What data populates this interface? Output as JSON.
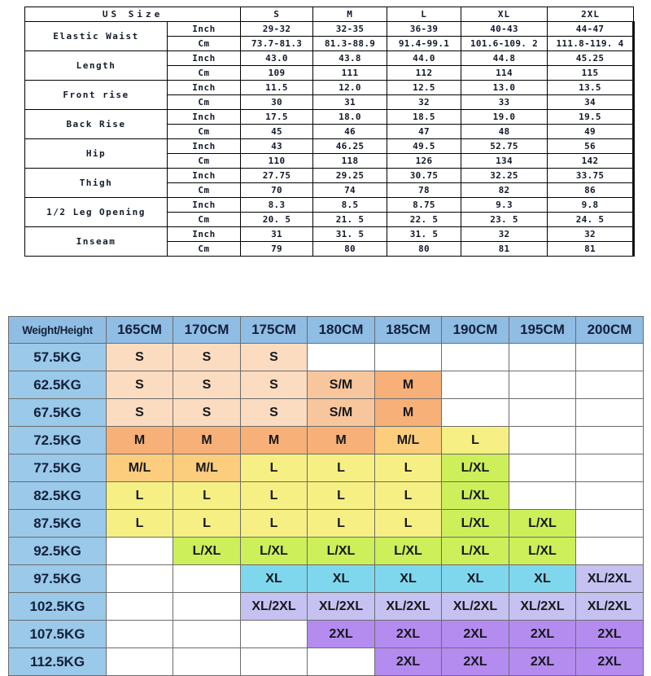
{
  "top_table": {
    "title": "US Size",
    "size_columns": [
      "S",
      "M",
      "L",
      "XL",
      "2XL"
    ],
    "units": [
      "Inch",
      "Cm"
    ],
    "rows": [
      {
        "label": "Elastic Waist",
        "inch": [
          "29-32",
          "32-35",
          "36-39",
          "40-43",
          "44-47"
        ],
        "cm": [
          "73.7-81.3",
          "81.3-88.9",
          "91.4-99.1",
          "101.6-109. 2",
          "111.8-119. 4"
        ]
      },
      {
        "label": "Length",
        "inch": [
          "43.0",
          "43.8",
          "44.0",
          "44.8",
          "45.25"
        ],
        "cm": [
          "109",
          "111",
          "112",
          "114",
          "115"
        ]
      },
      {
        "label": "Front rise",
        "inch": [
          "11.5",
          "12.0",
          "12.5",
          "13.0",
          "13.5"
        ],
        "cm": [
          "30",
          "31",
          "32",
          "33",
          "34"
        ]
      },
      {
        "label": "Back Rise",
        "inch": [
          "17.5",
          "18.0",
          "18.5",
          "19.0",
          "19.5"
        ],
        "cm": [
          "45",
          "46",
          "47",
          "48",
          "49"
        ]
      },
      {
        "label": "Hip",
        "inch": [
          "43",
          "46.25",
          "49.5",
          "52.75",
          "56"
        ],
        "cm": [
          "110",
          "118",
          "126",
          "134",
          "142"
        ]
      },
      {
        "label": "Thigh",
        "inch": [
          "27.75",
          "29.25",
          "30.75",
          "32.25",
          "33.75"
        ],
        "cm": [
          "70",
          "74",
          "78",
          "82",
          "86"
        ]
      },
      {
        "label": "1/2 Leg Opening",
        "inch": [
          "8.3",
          "8.5",
          "8.75",
          "9.3",
          "9.8"
        ],
        "cm": [
          "20. 5",
          "21. 5",
          "22. 5",
          "23. 5",
          "24. 5"
        ]
      },
      {
        "label": "Inseam",
        "inch": [
          "31",
          "31. 5",
          "31. 5",
          "32",
          "32"
        ],
        "cm": [
          "79",
          "80",
          "80",
          "81",
          "81"
        ]
      }
    ]
  },
  "bottom_table": {
    "corner_label": "Weight/Height",
    "height_columns": [
      "165CM",
      "170CM",
      "175CM",
      "180CM",
      "185CM",
      "190CM",
      "195CM",
      "200CM"
    ],
    "rows": [
      {
        "weight": "57.5KG",
        "cells": [
          "S",
          "S",
          "S",
          "",
          "",
          "",
          "",
          ""
        ]
      },
      {
        "weight": "62.5KG",
        "cells": [
          "S",
          "S",
          "S",
          "S/M",
          "M",
          "",
          "",
          ""
        ]
      },
      {
        "weight": "67.5KG",
        "cells": [
          "S",
          "S",
          "S",
          "S/M",
          "M",
          "",
          "",
          ""
        ]
      },
      {
        "weight": "72.5KG",
        "cells": [
          "M",
          "M",
          "M",
          "M",
          "M/L",
          "L",
          "",
          ""
        ]
      },
      {
        "weight": "77.5KG",
        "cells": [
          "M/L",
          "M/L",
          "L",
          "L",
          "L",
          "L/XL",
          "",
          ""
        ]
      },
      {
        "weight": "82.5KG",
        "cells": [
          "L",
          "L",
          "L",
          "L",
          "L",
          "L/XL",
          "",
          ""
        ]
      },
      {
        "weight": "87.5KG",
        "cells": [
          "L",
          "L",
          "L",
          "L",
          "L",
          "L/XL",
          "L/XL",
          ""
        ]
      },
      {
        "weight": "92.5KG",
        "cells": [
          "",
          "L/XL",
          "L/XL",
          "L/XL",
          "L/XL",
          "L/XL",
          "L/XL",
          ""
        ]
      },
      {
        "weight": "97.5KG",
        "cells": [
          "",
          "",
          "XL",
          "XL",
          "XL",
          "XL",
          "XL",
          "XL/2XL"
        ]
      },
      {
        "weight": "102.5KG",
        "cells": [
          "",
          "",
          "XL/2XL",
          "XL/2XL",
          "XL/2XL",
          "XL/2XL",
          "XL/2XL",
          "XL/2XL"
        ]
      },
      {
        "weight": "107.5KG",
        "cells": [
          "",
          "",
          "",
          "2XL",
          "2XL",
          "2XL",
          "2XL",
          "2XL"
        ]
      },
      {
        "weight": "112.5KG",
        "cells": [
          "",
          "",
          "",
          "",
          "2XL",
          "2XL",
          "2XL",
          "2XL"
        ]
      }
    ],
    "legend_colors": {
      "S": "#fbdcc0",
      "S/M": "#f8c69c",
      "M": "#f7b077",
      "M/L": "#fbcd7d",
      "L": "#f6ef84",
      "L/XL": "#ccef5a",
      "XL": "#7fd7ee",
      "XL/2XL": "#c5c2f2",
      "2XL": "#b48cf0"
    }
  }
}
